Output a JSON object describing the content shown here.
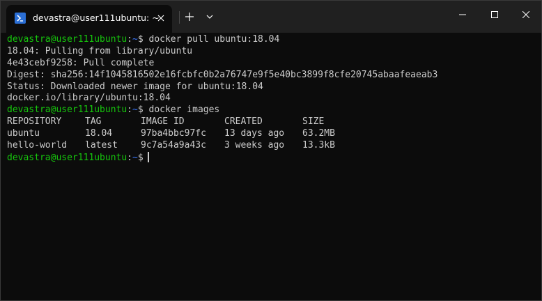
{
  "window": {
    "tab_title": "devastra@user111ubuntu: ~",
    "tab_icon": "terminal-icon",
    "new_tab_icon": "plus-icon",
    "dropdown_icon": "chevron-down-icon"
  },
  "colors": {
    "background": "#0c0c0c",
    "titlebar": "#202020",
    "prompt_user": "#16c60c",
    "prompt_path": "#3b78ff",
    "text": "#cccccc"
  },
  "terminal": {
    "prompt": {
      "user_host": "devastra@user111ubuntu",
      "separator": ":",
      "path": "~",
      "symbol": "$"
    },
    "command1": "docker pull ubuntu:18.04",
    "output1": [
      "18.04: Pulling from library/ubuntu",
      "4e43cebf9258: Pull complete",
      "Digest: sha256:14f1045816502e16fcbfc0b2a76747e9f5e40bc3899f8cfe20745abaafeaeab3",
      "Status: Downloaded newer image for ubuntu:18.04",
      "docker.io/library/ubuntu:18.04"
    ],
    "command2": "docker images",
    "images_table": {
      "headers": [
        "REPOSITORY",
        "TAG",
        "IMAGE ID",
        "CREATED",
        "SIZE"
      ],
      "rows": [
        [
          "ubuntu",
          "18.04",
          "97ba4bbc97fc",
          "13 days ago",
          "63.2MB"
        ],
        [
          "hello-world",
          "latest",
          "9c7a54a9a43c",
          "3 weeks ago",
          "13.3kB"
        ]
      ]
    }
  }
}
